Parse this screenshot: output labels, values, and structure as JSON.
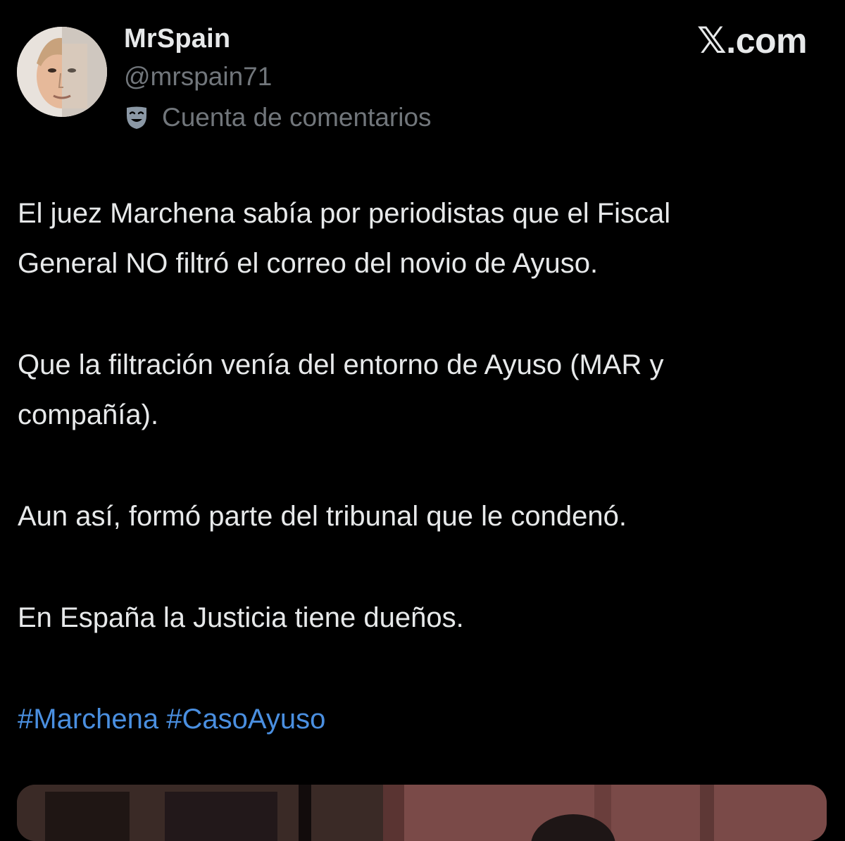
{
  "author": {
    "display_name": "MrSpain",
    "handle": "@mrspain71",
    "account_label": "Cuenta de comentarios",
    "account_label_icon": "mask-icon",
    "avatar_icon": "avatar-photo"
  },
  "brand": {
    "x_glyph": "𝕏",
    "domain": ".com"
  },
  "post": {
    "paragraphs": [
      "El juez Marchena sabía por periodistas que el Fiscal\nGeneral NO filtró el correo del novio de Ayuso.",
      "Que la filtración venía del entorno de Ayuso (MAR y\ncompañía).",
      "Aun así, formó parte del tribunal que le condenó.",
      "En España la Justicia tiene dueños."
    ],
    "hashtags": [
      "#Marchena",
      "#CasoAyuso"
    ]
  },
  "colors": {
    "background": "#000000",
    "text_primary": "#e7e9ea",
    "text_secondary": "#71767b",
    "hashtag": "#4a8fe0"
  }
}
